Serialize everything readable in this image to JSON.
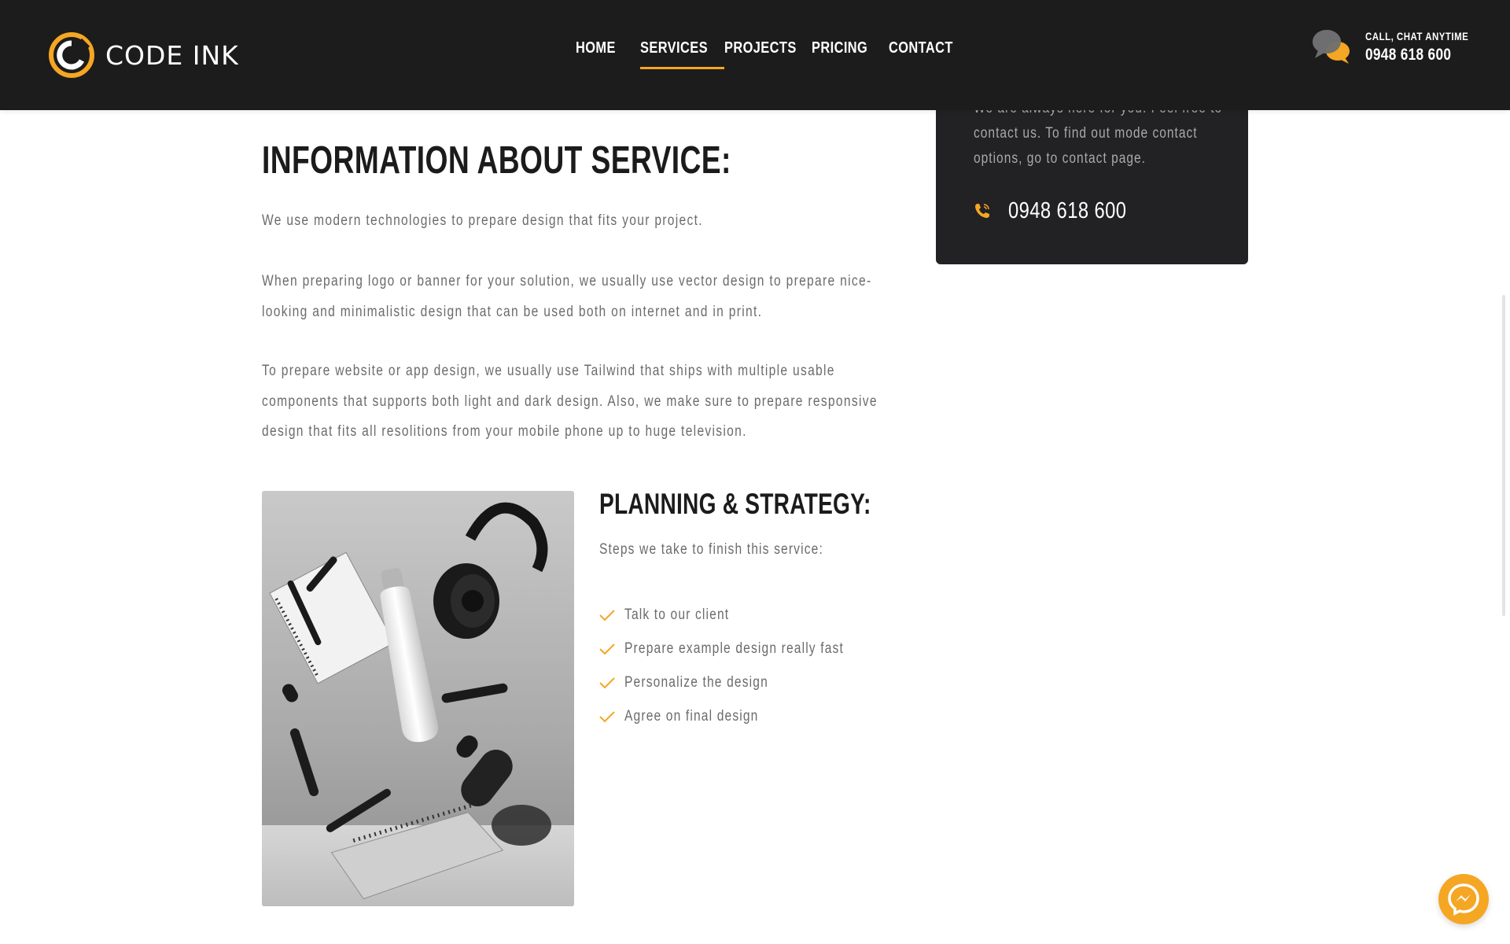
{
  "brand": {
    "name": "CODE INK",
    "accent_color": "#f5a623",
    "dark_color": "#1c1c1c"
  },
  "nav": {
    "items": [
      {
        "label": "HOME",
        "active": false
      },
      {
        "label": "SERVICES",
        "active": true
      },
      {
        "label": "PROJECTS",
        "active": false
      },
      {
        "label": "PRICING",
        "active": false
      },
      {
        "label": "CONTACT",
        "active": false
      }
    ]
  },
  "header_contact": {
    "label": "CALL, CHAT ANYTIME",
    "phone": "0948 618 600",
    "icon": "chat-bubbles-icon"
  },
  "sidebar_card": {
    "text": "We are always here for you. Feel free to contact us. To find out mode contact options, go to contact page.",
    "phone": "0948 618 600",
    "icon": "phone-icon"
  },
  "main": {
    "title": "INFORMATION ABOUT SERVICE:",
    "paragraphs": [
      "We use modern technologies to prepare design that fits your project.",
      "When preparing logo or banner for your solution, we usually use vector design to prepare nice-looking and minimalistic design that can be used both on internet and in print.",
      "To prepare website or app design, we usually use Tailwind that ships with multiple usable components that supports both light and dark design. Also, we make sure to prepare responsive design that fits all resolitions from your mobile phone up to huge television."
    ]
  },
  "planning": {
    "title": "PLANNING & STRATEGY:",
    "subtitle": "Steps we take to finish this service:",
    "steps": [
      "Talk to our client",
      "Prepare example design really fast",
      "Personalize the design",
      "Agree on final design"
    ],
    "step_icon": "check-icon"
  },
  "image": {
    "subject": "floating-stationery-photo"
  },
  "floating_button": {
    "icon": "messenger-icon"
  }
}
